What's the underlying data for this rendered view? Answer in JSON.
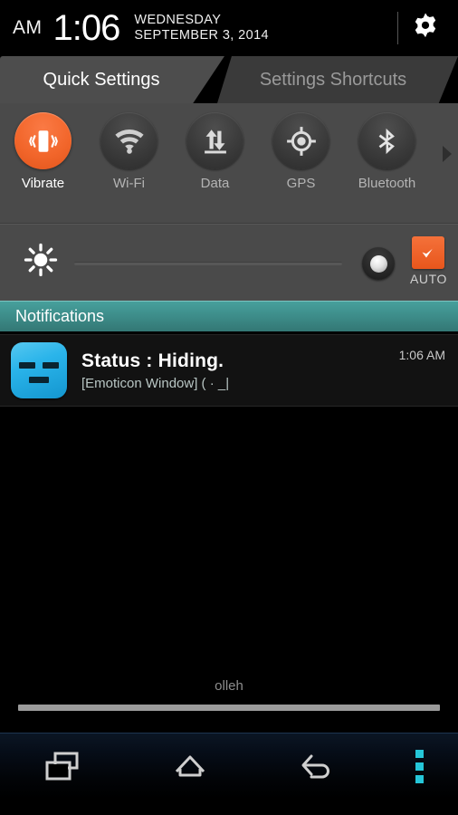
{
  "status_bar": {
    "ampm": "AM",
    "time": "1:06",
    "weekday": "WEDNESDAY",
    "date": "SEPTEMBER 3, 2014",
    "settings_icon": "gear-icon"
  },
  "tabs": [
    {
      "label": "Quick Settings",
      "active": true
    },
    {
      "label": "Settings Shortcuts",
      "active": false
    }
  ],
  "quick_settings": {
    "scroll_indicator": "chevron-right-icon",
    "tiles": [
      {
        "label": "Vibrate",
        "icon": "vibrate-icon",
        "active": true
      },
      {
        "label": "Wi-Fi",
        "icon": "wifi-icon",
        "active": false
      },
      {
        "label": "Data",
        "icon": "data-sync-icon",
        "active": false
      },
      {
        "label": "GPS",
        "icon": "gps-icon",
        "active": false
      },
      {
        "label": "Bluetooth",
        "icon": "bluetooth-icon",
        "active": false
      }
    ]
  },
  "brightness": {
    "icon": "brightness-sun-icon",
    "auto_label": "AUTO",
    "auto_checked": true,
    "check_icon": "checkmark-icon",
    "slider_value": 88
  },
  "notifications_header": {
    "title": "Notifications"
  },
  "notifications": [
    {
      "icon": "emoticon-face-icon",
      "title": "Status : Hiding.",
      "subtitle": "[Emoticon Window] ( · _|",
      "time": "1:06 AM"
    }
  ],
  "footer": {
    "carrier": "olleh"
  },
  "nav_bar": {
    "buttons": [
      {
        "name": "recents",
        "icon": "recents-icon"
      },
      {
        "name": "home",
        "icon": "home-icon"
      },
      {
        "name": "back",
        "icon": "back-icon"
      },
      {
        "name": "menu",
        "icon": "overflow-menu-icon"
      }
    ]
  },
  "colors": {
    "accent_orange": "#ef6a2c",
    "accent_teal": "#3c8a87",
    "panel_gray": "#4a4a4a",
    "nav_dot_teal": "#25c6d8",
    "notif_icon_blue": "#2ab4ea"
  }
}
